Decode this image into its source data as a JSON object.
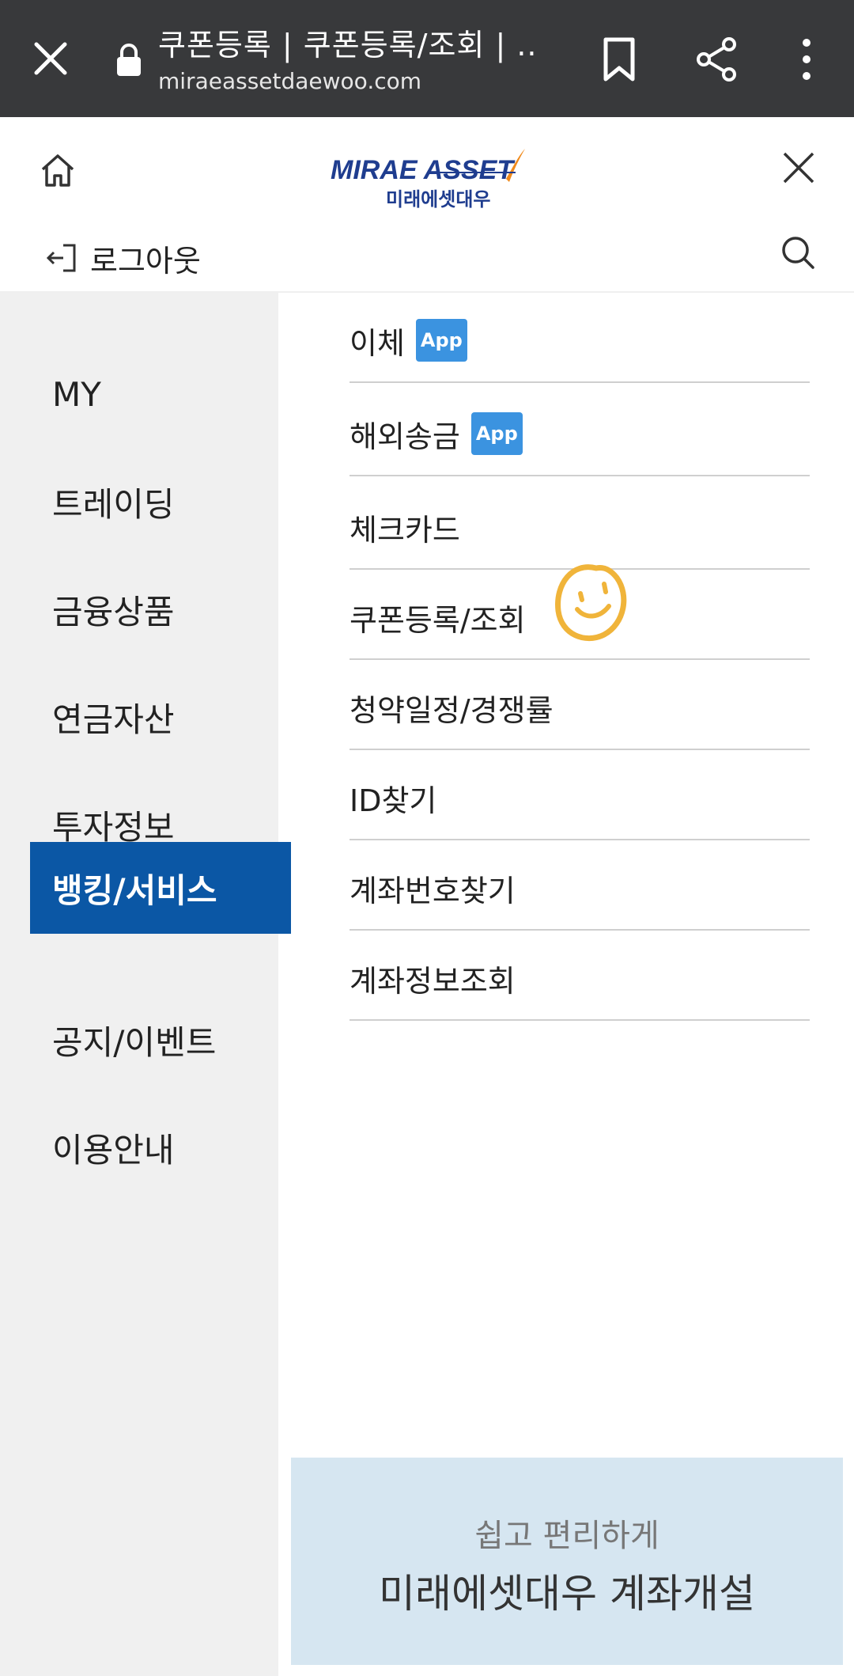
{
  "browser": {
    "title": "쿠폰등록 | 쿠폰등록/조회 | ...",
    "url": "miraeassetdaewoo.com"
  },
  "header": {
    "logo_en": "MIRAE ASSET",
    "logo_ko": "미래에셋대우",
    "logout_label": "로그아웃"
  },
  "left_nav": {
    "items": [
      {
        "label": "MY"
      },
      {
        "label": "트레이딩"
      },
      {
        "label": "금융상품"
      },
      {
        "label": "연금자산"
      },
      {
        "label": "투자정보"
      },
      {
        "label": "뱅킹/서비스",
        "active": true
      },
      {
        "label": "공지/이벤트"
      },
      {
        "label": "이용안내"
      }
    ]
  },
  "submenu": {
    "items": [
      {
        "label": "이체",
        "badge": "App"
      },
      {
        "label": "해외송금",
        "badge": "App"
      },
      {
        "label": "체크카드"
      },
      {
        "label": "쿠폰등록/조회"
      },
      {
        "label": "청약일정/경쟁률"
      },
      {
        "label": "ID찾기"
      },
      {
        "label": "계좌번호찾기"
      },
      {
        "label": "계좌정보조회"
      }
    ]
  },
  "banner": {
    "subtitle": "쉽고 편리하게",
    "title": "미래에셋대우 계좌개설"
  },
  "colors": {
    "browser_bar": "#38393b",
    "active_nav": "#0b57a5",
    "app_badge": "#3b93e0",
    "banner_bg": "#d6e6f1",
    "nav_bg": "#f0f0f0",
    "logo_orange": "#f08a1c"
  }
}
